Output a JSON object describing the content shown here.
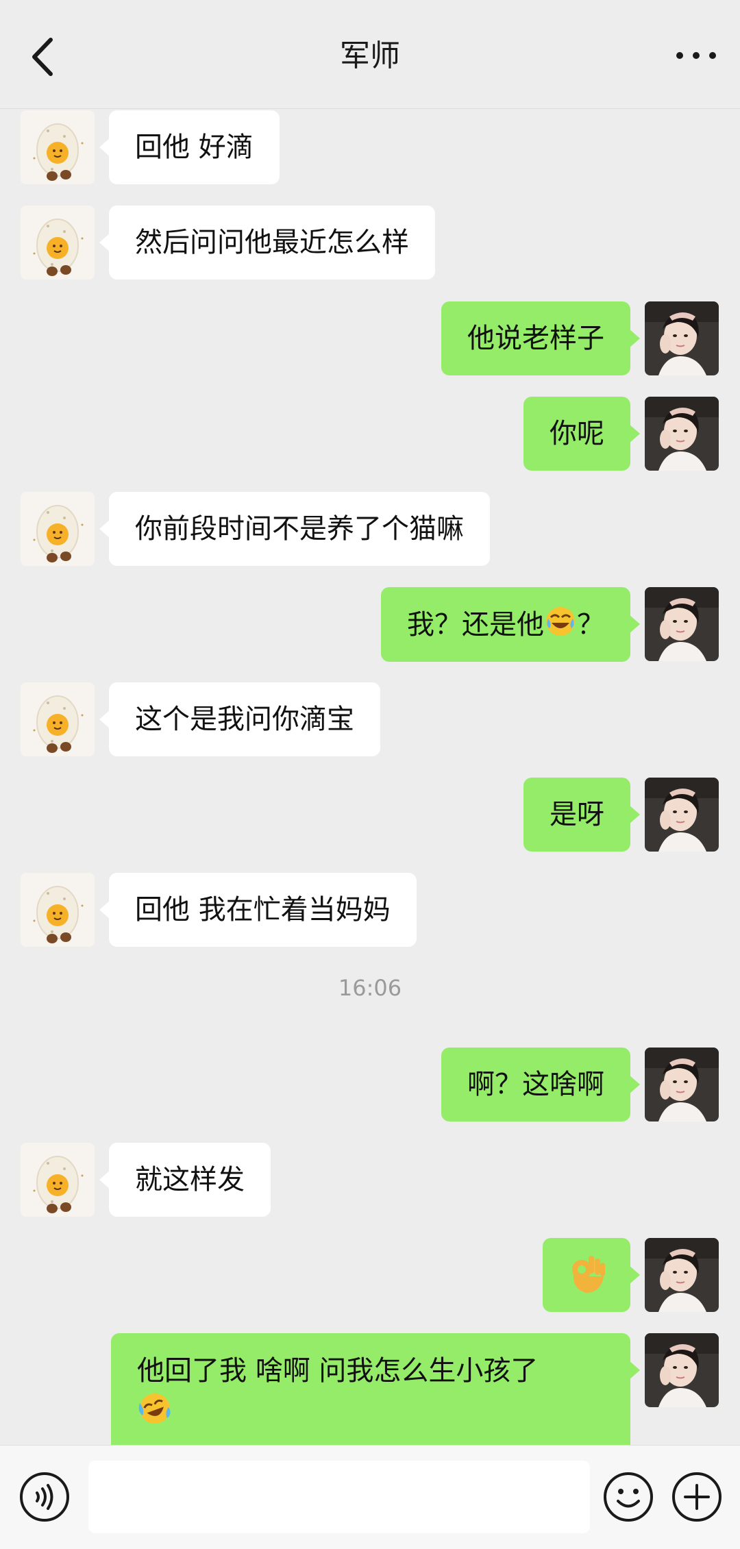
{
  "header": {
    "title": "军师"
  },
  "messages": [
    {
      "side": "in",
      "text": "回他 好滴"
    },
    {
      "side": "in",
      "text": "然后问问他最近怎么样"
    },
    {
      "side": "out",
      "text": "他说老样子"
    },
    {
      "side": "out",
      "text": "你呢"
    },
    {
      "side": "in",
      "text": "你前段时间不是养了个猫嘛"
    },
    {
      "side": "out",
      "text": "我？还是他",
      "emoji": "tears-of-joy",
      "text_after": "？"
    },
    {
      "side": "in",
      "text": "这个是我问你滴宝"
    },
    {
      "side": "out",
      "text": "是呀"
    },
    {
      "side": "in",
      "text": "回他 我在忙着当妈妈"
    },
    {
      "side": "out",
      "text": "啊？这啥啊"
    },
    {
      "side": "in",
      "text": "就这样发"
    },
    {
      "side": "out",
      "emoji": "ok-hand"
    },
    {
      "side": "out",
      "text": "他回了我 啥啊 问我怎么生小孩了",
      "emoji": "crying-laughing"
    }
  ],
  "timestamp": "16:06",
  "composer": {
    "input_value": ""
  },
  "icons": {
    "left_avatar": "egg-avatar",
    "right_avatar": "user-photo-avatar",
    "voice": "voice-icon",
    "emoji": "emoji-icon",
    "plus": "plus-icon"
  },
  "colors": {
    "background": "#ededed",
    "incoming_bubble": "#ffffff",
    "outgoing_bubble": "#95ec69",
    "timestamp": "#9a9a9a"
  }
}
